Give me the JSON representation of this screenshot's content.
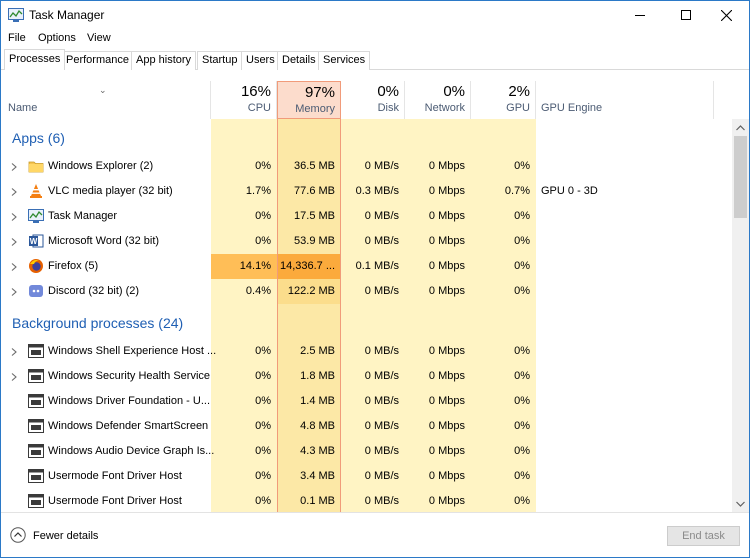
{
  "window": {
    "title": "Task Manager"
  },
  "menu": [
    "File",
    "Options",
    "View"
  ],
  "tabs": [
    "Processes",
    "Performance",
    "App history",
    "Startup",
    "Users",
    "Details",
    "Services"
  ],
  "active_tab": "Processes",
  "header": {
    "name_label": "Name",
    "columns": [
      {
        "pct": "16%",
        "label": "CPU"
      },
      {
        "pct": "97%",
        "label": "Memory"
      },
      {
        "pct": "0%",
        "label": "Disk"
      },
      {
        "pct": "0%",
        "label": "Network"
      },
      {
        "pct": "2%",
        "label": "GPU"
      }
    ],
    "gpu_engine_label": "GPU Engine"
  },
  "groups": {
    "apps": {
      "title": "Apps (6)",
      "rows": [
        {
          "name": "Windows Explorer (2)",
          "icon": "folder-icon",
          "cpu": "0%",
          "memory": "36.5 MB",
          "disk": "0 MB/s",
          "network": "0 Mbps",
          "gpu": "0%",
          "gpu_engine": ""
        },
        {
          "name": "VLC media player (32 bit)",
          "icon": "vlc-icon",
          "cpu": "1.7%",
          "memory": "77.6 MB",
          "disk": "0.3 MB/s",
          "network": "0 Mbps",
          "gpu": "0.7%",
          "gpu_engine": "GPU 0 - 3D"
        },
        {
          "name": "Task Manager",
          "icon": "task-manager-icon",
          "cpu": "0%",
          "memory": "17.5 MB",
          "disk": "0 MB/s",
          "network": "0 Mbps",
          "gpu": "0%",
          "gpu_engine": ""
        },
        {
          "name": "Microsoft Word (32 bit)",
          "icon": "word-icon",
          "cpu": "0%",
          "memory": "53.9 MB",
          "disk": "0 MB/s",
          "network": "0 Mbps",
          "gpu": "0%",
          "gpu_engine": ""
        },
        {
          "name": "Firefox (5)",
          "icon": "firefox-icon",
          "cpu": "14.1%",
          "memory": "14,336.7 ...",
          "disk": "0.1 MB/s",
          "network": "0 Mbps",
          "gpu": "0%",
          "gpu_engine": ""
        },
        {
          "name": "Discord (32 bit) (2)",
          "icon": "discord-icon",
          "cpu": "0.4%",
          "memory": "122.2 MB",
          "disk": "0 MB/s",
          "network": "0 Mbps",
          "gpu": "0%",
          "gpu_engine": ""
        }
      ]
    },
    "background": {
      "title": "Background processes (24)",
      "rows": [
        {
          "name": "Windows Shell Experience Host ...",
          "icon": "app-window-icon",
          "expander": true,
          "cpu": "0%",
          "memory": "2.5 MB",
          "disk": "0 MB/s",
          "network": "0 Mbps",
          "gpu": "0%"
        },
        {
          "name": "Windows Security Health Service",
          "icon": "app-window-icon",
          "expander": true,
          "cpu": "0%",
          "memory": "1.8 MB",
          "disk": "0 MB/s",
          "network": "0 Mbps",
          "gpu": "0%"
        },
        {
          "name": "Windows Driver Foundation - U...",
          "icon": "app-window-icon",
          "expander": false,
          "cpu": "0%",
          "memory": "1.4 MB",
          "disk": "0 MB/s",
          "network": "0 Mbps",
          "gpu": "0%"
        },
        {
          "name": "Windows Defender SmartScreen",
          "icon": "app-window-icon",
          "expander": false,
          "cpu": "0%",
          "memory": "4.8 MB",
          "disk": "0 MB/s",
          "network": "0 Mbps",
          "gpu": "0%"
        },
        {
          "name": "Windows Audio Device Graph Is...",
          "icon": "app-window-icon",
          "expander": false,
          "cpu": "0%",
          "memory": "4.3 MB",
          "disk": "0 MB/s",
          "network": "0 Mbps",
          "gpu": "0%"
        },
        {
          "name": "Usermode Font Driver Host",
          "icon": "app-window-icon",
          "expander": false,
          "cpu": "0%",
          "memory": "3.4 MB",
          "disk": "0 MB/s",
          "network": "0 Mbps",
          "gpu": "0%"
        },
        {
          "name": "Usermode Font Driver Host",
          "icon": "app-window-icon",
          "expander": false,
          "cpu": "0%",
          "memory": "0.1 MB",
          "disk": "0 MB/s",
          "network": "0 Mbps",
          "gpu": "0%"
        }
      ]
    }
  },
  "footer": {
    "fewer_details": "Fewer details",
    "end_task": "End task"
  },
  "colors": {
    "heat_light": "#fff4c4",
    "heat_mid": "#f9ecab",
    "heat_memory": "#fbe29a",
    "heat_hot": "#fbaa3c",
    "heat_orange": "#ffbe57",
    "accent_blue": "#1f5fb3"
  }
}
